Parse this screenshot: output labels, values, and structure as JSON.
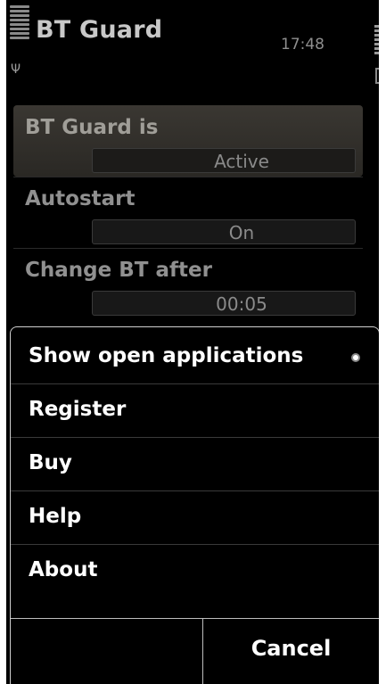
{
  "status_bar": {
    "app_title": "BT Guard",
    "time": "17:48",
    "signal_icon": "signal-bars-icon",
    "battery_icon": "battery-bars-icon"
  },
  "settings": [
    {
      "label": "BT Guard is",
      "value": "Active",
      "selected": true
    },
    {
      "label": "Autostart",
      "value": "On",
      "selected": false
    },
    {
      "label": "Change BT after",
      "value": "00:05",
      "selected": false
    }
  ],
  "menu": {
    "items": [
      {
        "label": "Show open applications",
        "indicator": "radio-dot-icon"
      },
      {
        "label": "Register"
      },
      {
        "label": "Buy"
      },
      {
        "label": "Help"
      },
      {
        "label": "About"
      }
    ],
    "softkeys": {
      "left": "",
      "right": "Cancel"
    }
  },
  "colors": {
    "background": "#000000",
    "menu_text": "#ffffff",
    "dim_text": "#909090",
    "popup_border": "#cfcfcf",
    "selected_row": "#3a3732"
  }
}
